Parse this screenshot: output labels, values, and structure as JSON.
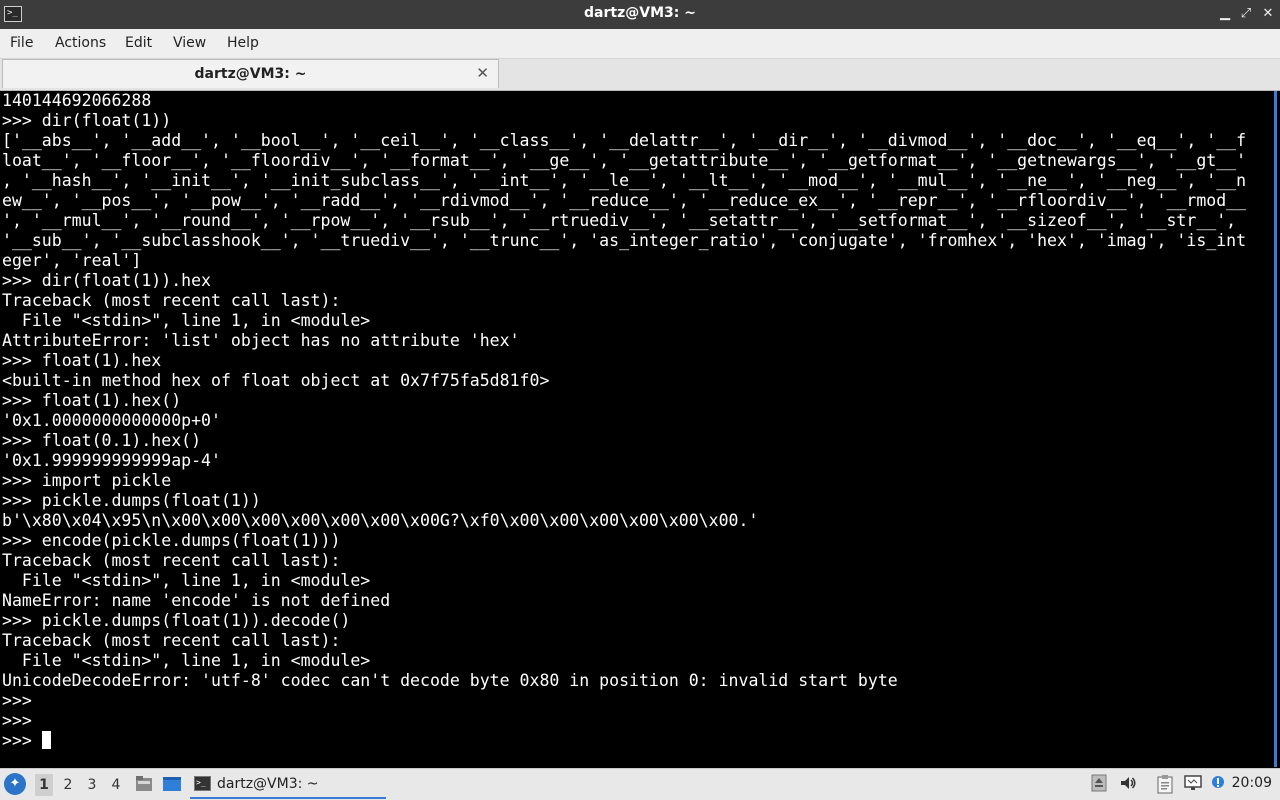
{
  "window": {
    "title": "dartz@VM3: ~",
    "controls": {
      "minimize": "▁",
      "maximize": "⤢",
      "close": "✕"
    }
  },
  "menu": [
    "File",
    "Actions",
    "Edit",
    "View",
    "Help"
  ],
  "tab": {
    "label": "dartz@VM3: ~",
    "close": "✕"
  },
  "terminal": {
    "lines": [
      "140144692066288",
      ">>> dir(float(1))",
      "['__abs__', '__add__', '__bool__', '__ceil__', '__class__', '__delattr__', '__dir__', '__divmod__', '__doc__', '__eq__', '__f",
      "loat__', '__floor__', '__floordiv__', '__format__', '__ge__', '__getattribute__', '__getformat__', '__getnewargs__', '__gt__'",
      ", '__hash__', '__init__', '__init_subclass__', '__int__', '__le__', '__lt__', '__mod__', '__mul__', '__ne__', '__neg__', '__n",
      "ew__', '__pos__', '__pow__', '__radd__', '__rdivmod__', '__reduce__', '__reduce_ex__', '__repr__', '__rfloordiv__', '__rmod__",
      "', '__rmul__', '__round__', '__rpow__', '__rsub__', '__rtruediv__', '__setattr__', '__setformat__', '__sizeof__', '__str__',",
      "'__sub__', '__subclasshook__', '__truediv__', '__trunc__', 'as_integer_ratio', 'conjugate', 'fromhex', 'hex', 'imag', 'is_int",
      "eger', 'real']",
      ">>> dir(float(1)).hex",
      "Traceback (most recent call last):",
      "  File \"<stdin>\", line 1, in <module>",
      "AttributeError: 'list' object has no attribute 'hex'",
      ">>> float(1).hex",
      "<built-in method hex of float object at 0x7f75fa5d81f0>",
      ">>> float(1).hex()",
      "'0x1.0000000000000p+0'",
      ">>> float(0.1).hex()",
      "'0x1.999999999999ap-4'",
      ">>> import pickle",
      ">>> pickle.dumps(float(1))",
      "b'\\x80\\x04\\x95\\n\\x00\\x00\\x00\\x00\\x00\\x00\\x00G?\\xf0\\x00\\x00\\x00\\x00\\x00\\x00.'",
      ">>> encode(pickle.dumps(float(1)))",
      "Traceback (most recent call last):",
      "  File \"<stdin>\", line 1, in <module>",
      "NameError: name 'encode' is not defined",
      ">>> pickle.dumps(float(1)).decode()",
      "Traceback (most recent call last):",
      "  File \"<stdin>\", line 1, in <module>",
      "UnicodeDecodeError: 'utf-8' codec can't decode byte 0x80 in position 0: invalid start byte",
      ">>>",
      ">>>"
    ],
    "prompt": ">>> "
  },
  "taskbar": {
    "workspaces": [
      "1",
      "2",
      "3",
      "4"
    ],
    "active_workspace": "1",
    "task": {
      "label": "dartz@VM3: ~"
    },
    "clock": "20:09",
    "icons": [
      "start-menu-icon",
      "file-manager-icon",
      "desktop-icon",
      "terminal-icon",
      "update-icon",
      "volume-icon",
      "clipboard-icon",
      "network-icon",
      "notification-icon"
    ]
  }
}
